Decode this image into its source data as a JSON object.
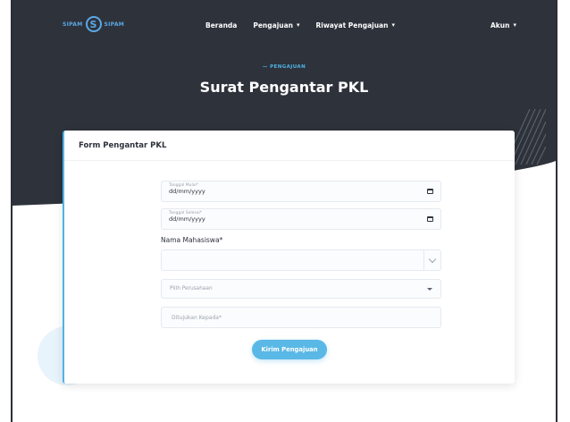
{
  "brand": {
    "left_text": "SIPAM",
    "logo_letter": "S",
    "right_text": "SIPAM"
  },
  "nav": {
    "items": [
      {
        "label": "Beranda",
        "caret": ""
      },
      {
        "label": "Pengajuan",
        "caret": "▾"
      },
      {
        "label": "Riwayat Pengajuan",
        "caret": "▾"
      }
    ],
    "account": {
      "label": "Akun",
      "caret": "▾"
    }
  },
  "hero": {
    "kicker": "— PENGAJUAN",
    "title": "Surat Pengantar PKL"
  },
  "card": {
    "title": "Form Pengantar PKL"
  },
  "form": {
    "start_date": {
      "label": "Tanggal Mulai*",
      "value": "dd/mm/yyyy"
    },
    "end_date": {
      "label": "Tanggal Selesai*",
      "value": "dd/mm/yyyy"
    },
    "student_name": {
      "label": "Nama Mahasiswa*",
      "value": ""
    },
    "company": {
      "placeholder": "Pilih Perusahaan"
    },
    "recipient": {
      "placeholder": "Ditujukan Kepada*",
      "value": ""
    },
    "submit_label": "Kirim Pengajuan"
  },
  "colors": {
    "hero_bg": "#2e323b",
    "accent": "#5ab8e6"
  },
  "icons": {
    "calendar": "calendar-icon",
    "chevron": "chevron-down-icon",
    "select_triangle": "caret-down-icon"
  }
}
